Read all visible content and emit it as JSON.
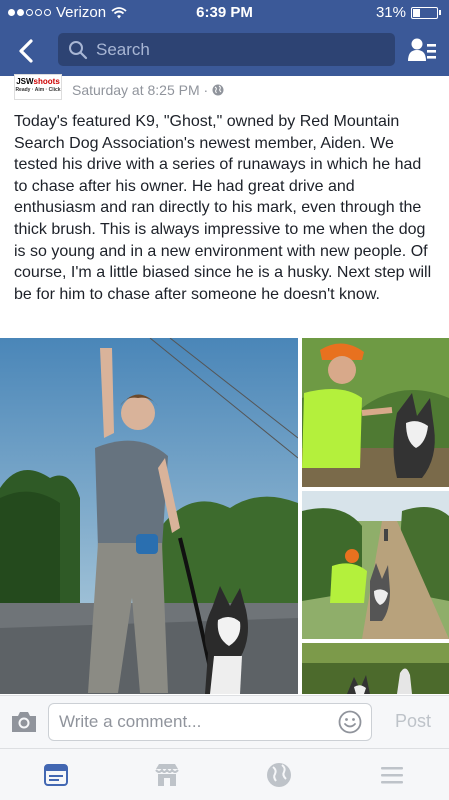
{
  "status_bar": {
    "carrier": "Verizon",
    "time": "6:39 PM",
    "battery": "31%",
    "battery_level": 0.31,
    "signal_bars_filled": 2,
    "signal_bars_total": 5
  },
  "navbar": {
    "search_placeholder": "Search",
    "back_icon": "chevron-left-icon",
    "friends_icon": "friend-requests-icon"
  },
  "post": {
    "page_logo_text": "JSWshoots",
    "page_logo_sub": "Ready · Aim · Click",
    "timestamp": "Saturday at 8:25 PM · ",
    "privacy_icon": "globe-icon",
    "text": "Today's featured K9, \"Ghost,\" owned by Red Mountain Search Dog Association's newest member, Aiden. We tested his drive with a series of runaways in which he had to chase after his owner. He had great drive and enthusiasm and ran directly to his mark, even through the thick brush. This is always impressive to me when the dog is so young and in a new environment with new people. Of course, I'm a little biased since he is a husky. Next step will be for him to chase after someone he doesn't know.",
    "photo_count": 4
  },
  "comment_bar": {
    "placeholder": "Write a comment...",
    "post_label": "Post",
    "camera_icon": "camera-icon",
    "emoji_icon": "emoji-icon"
  },
  "tabs": [
    {
      "name": "news-feed",
      "icon": "news-feed-icon",
      "active": true
    },
    {
      "name": "marketplace",
      "icon": "marketplace-icon",
      "active": false
    },
    {
      "name": "notifications",
      "icon": "globe-icon",
      "active": false
    },
    {
      "name": "menu",
      "icon": "menu-icon",
      "active": false
    }
  ],
  "colors": {
    "brand": "#3b5998",
    "active_tab": "#4267b2",
    "inactive_tab": "#bec3c9"
  }
}
